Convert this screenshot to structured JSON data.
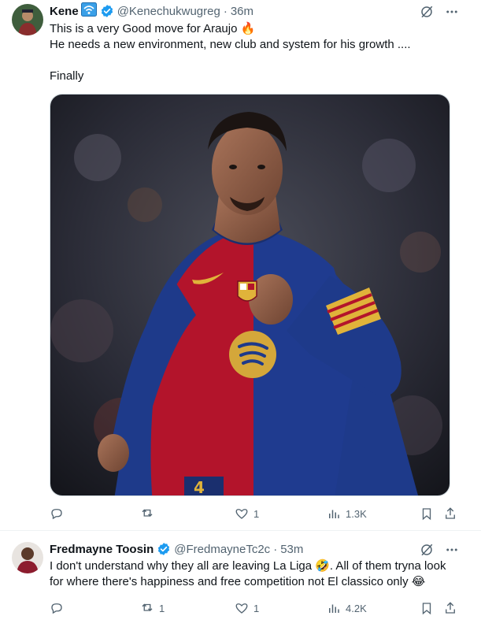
{
  "tweets": [
    {
      "author": {
        "name": "Kene",
        "handle": "@Kenechukwugreg",
        "time": "36m",
        "badge_icon": "wifi-badge-icon",
        "verified": true
      },
      "lines": [
        "This is a very Good move for Araujo 🔥",
        "He needs a new environment, new club and system  for his growth ....",
        "",
        "Finally"
      ],
      "stats": {
        "replies": "",
        "retweets": "",
        "likes": "1",
        "views": "1.3K"
      }
    },
    {
      "author": {
        "name": "Fredmayne Toosin",
        "handle": "@FredmayneTc2c",
        "time": "53m",
        "verified": true
      },
      "lines": [
        "I don't understand why they all are leaving La Liga 🤣. All of them tryna look",
        "for where there's happiness and free competition not El classico only 😂"
      ],
      "stats": {
        "replies": "",
        "retweets": "1",
        "likes": "1",
        "views": "4.2K"
      }
    }
  ],
  "dot": "·",
  "colors": {
    "accent": "#1d9bf0",
    "text": "#0f1419",
    "muted": "#536471",
    "jersey_red": "#b3142b",
    "jersey_blue": "#1e3a8a",
    "sponsor_gold": "#d4a73a"
  }
}
